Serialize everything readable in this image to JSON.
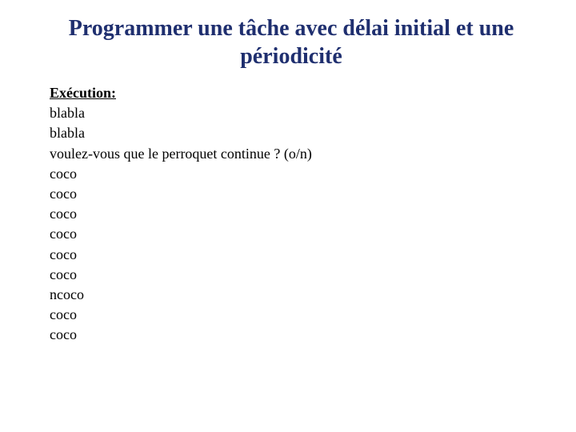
{
  "title": "Programmer une tâche avec délai initial et une périodicité",
  "section_header": "Exécution:",
  "lines": [
    "blabla",
    "blabla",
    "voulez-vous que le perroquet continue ? (o/n)",
    "coco",
    "coco",
    "coco",
    "coco",
    "coco",
    "coco",
    "ncoco",
    "coco",
    "coco"
  ]
}
